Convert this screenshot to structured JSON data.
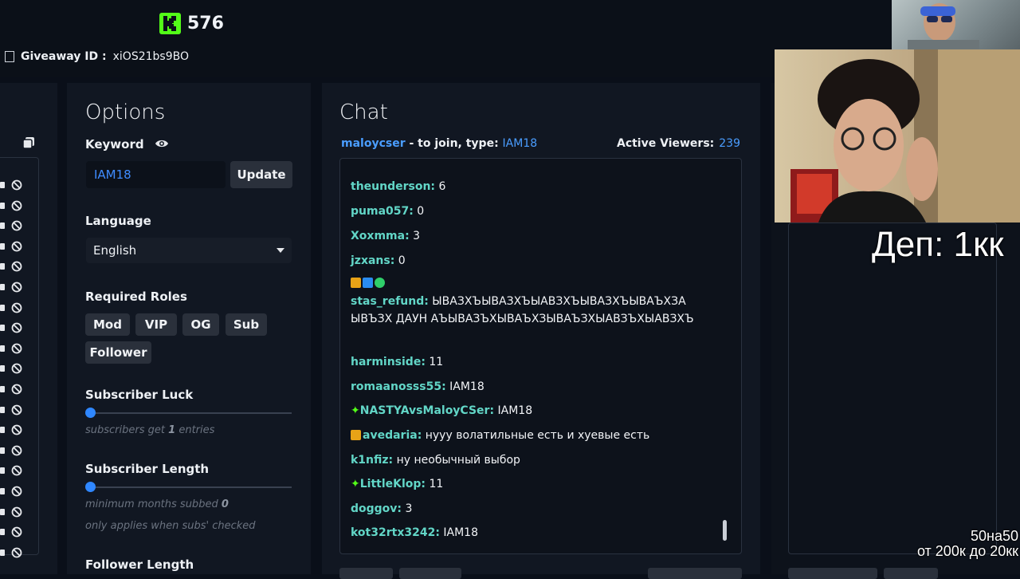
{
  "header": {
    "logo_count": "576",
    "giveaway_label": "Giveaway ID :",
    "giveaway_id": "xiOS21bs9BO"
  },
  "options": {
    "title": "Options",
    "keyword_label": "Keyword",
    "keyword_value": "IAM18",
    "update_label": "Update",
    "language_label": "Language",
    "language_value": "English",
    "roles_label": "Required Roles",
    "roles": [
      "Mod",
      "VIP",
      "OG",
      "Sub",
      "Follower"
    ],
    "sub_luck_label": "Subscriber Luck",
    "sub_luck_hint_pre": "subscribers get",
    "sub_luck_value": "1",
    "sub_luck_hint_post": "entries",
    "sub_length_label": "Subscriber Length",
    "sub_length_hint": "minimum months subbed",
    "sub_length_value": "0",
    "sub_length_note": "only applies when subs' checked",
    "follower_length_label": "Follower Length"
  },
  "chat": {
    "title": "Chat",
    "streamer": "maloycser",
    "join_text": " - to join, type: ",
    "join_keyword": "IAM18",
    "viewers_label": "Active Viewers:",
    "viewers_count": "239",
    "messages": [
      {
        "name": "theunderson:",
        "text": " 6"
      },
      {
        "name": "puma057:",
        "text": " 0"
      },
      {
        "name": "Xoxmma:",
        "text": " 3"
      },
      {
        "name": "jzxans:",
        "text": " 0"
      },
      {
        "name": "stas_refund:",
        "text": " ЫВАЗХЪЫВАЗХЪЫАВЗХЪЫВАЗХЪЫВАЪХЗА ЫВЪЗХ ДАУН АЪЫВАЗЪХЫВАЪХЗЫВАЪЗХЫАВЗЪХЫАВЗХЪ"
      },
      {
        "name": "harminside:",
        "text": " 11"
      },
      {
        "name": "romaanosss55:",
        "text": " IAM18"
      },
      {
        "name": "NASTYAvsMaloyCSer:",
        "text": " IAM18"
      },
      {
        "name": "avedaria:",
        "text": " нууу волатильные есть и хуевые есть"
      },
      {
        "name": "k1nfiz:",
        "text": " ну необычный выбор"
      },
      {
        "name": "LittleKlop:",
        "text": " 11"
      },
      {
        "name": "doggov:",
        "text": " 3"
      },
      {
        "name": "kot32rtx3242:",
        "text": " IAM18"
      }
    ]
  },
  "overlay": {
    "dep": "Деп: 1кк",
    "line1": "50на50",
    "line2": "от 200к до 20кк"
  },
  "colors": {
    "accent_blue": "#4a9dff",
    "username_teal": "#62d6c7",
    "kick_green": "#53fc18"
  }
}
